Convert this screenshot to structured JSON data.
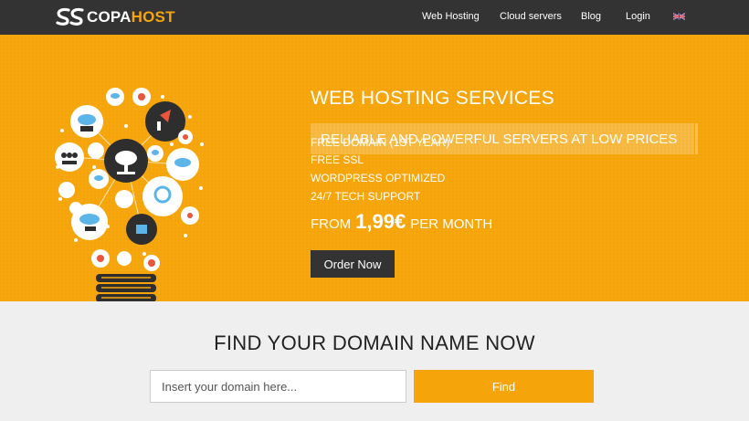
{
  "navbar": {
    "logo": {
      "part1": "COPA",
      "part2": "HOST",
      "icon": "copahost-s-logo-icon"
    },
    "links": [
      {
        "label": "Web Hosting"
      },
      {
        "label": "Cloud servers"
      },
      {
        "label": "Blog"
      },
      {
        "label": "Login"
      }
    ],
    "language_icon": "uk-flag-icon"
  },
  "hero": {
    "title": "WEB HOSTING SERVICES",
    "tagline": "RELIABLE AND POWERFUL SERVERS AT LOW PRICES",
    "features": [
      "FREE DOMAIN (1ST YEAR)",
      "FREE SSL",
      "WORDPRESS OPTIMIZED",
      "24/7 TECH SUPPORT"
    ],
    "price": {
      "prefix": "FROM",
      "amount": "1,99€",
      "suffix": "PER MONTH"
    },
    "order_button": "Order Now",
    "illustration": "lightbulb-cloud-icons-illustration"
  },
  "domain_search": {
    "title": "FIND YOUR DOMAIN NAME NOW",
    "placeholder": "Insert your domain here...",
    "button": "Find"
  },
  "colors": {
    "accent": "#f5a50a",
    "navbar_bg": "#333333",
    "section_bg": "#efefef",
    "button_dark": "#333333"
  }
}
